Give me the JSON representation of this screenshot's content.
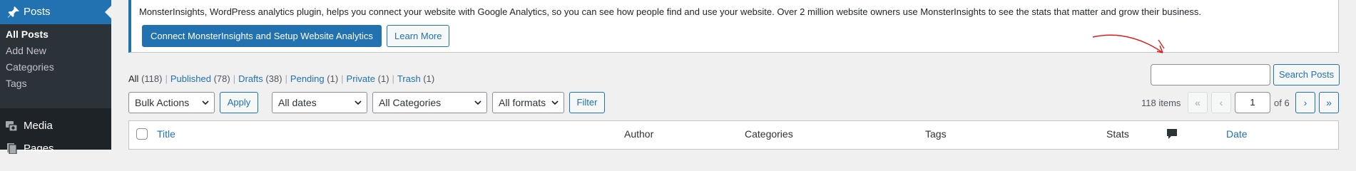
{
  "sidebar": {
    "posts_label": "Posts",
    "submenu": [
      {
        "label": "All Posts",
        "current": true
      },
      {
        "label": "Add New"
      },
      {
        "label": "Categories"
      },
      {
        "label": "Tags"
      }
    ],
    "media_label": "Media",
    "pages_label": "Pages"
  },
  "notice": {
    "message": "MonsterInsights, WordPress analytics plugin, helps you connect your website with Google Analytics, so you can see how people find and use your website. Over 2 million website owners use MonsterInsights to see the stats that matter and grow their business.",
    "primary_button": "Connect MonsterInsights and Setup Website Analytics",
    "secondary_button": "Learn More"
  },
  "status_filters": [
    {
      "label": "All",
      "count": "(118)"
    },
    {
      "label": "Published",
      "count": "(78)"
    },
    {
      "label": "Drafts",
      "count": "(38)"
    },
    {
      "label": "Pending",
      "count": "(1)"
    },
    {
      "label": "Private",
      "count": "(1)"
    },
    {
      "label": "Trash",
      "count": "(1)"
    }
  ],
  "search": {
    "value": "",
    "button": "Search Posts"
  },
  "tablenav": {
    "bulk_actions": "Bulk Actions",
    "apply": "Apply",
    "dates": "All dates",
    "categories": "All Categories",
    "formats": "All formats",
    "filter": "Filter",
    "items_count": "118 items",
    "first": "«",
    "prev": "‹",
    "current_page": "1",
    "of_pages": "of 6",
    "next": "›",
    "last": "»"
  },
  "table": {
    "columns": {
      "title": "Title",
      "author": "Author",
      "categories": "Categories",
      "tags": "Tags",
      "stats": "Stats",
      "date": "Date"
    }
  },
  "colors": {
    "accent": "#2271b1",
    "sidebar_bg": "#1d2327",
    "annotation": "#e0191b"
  }
}
